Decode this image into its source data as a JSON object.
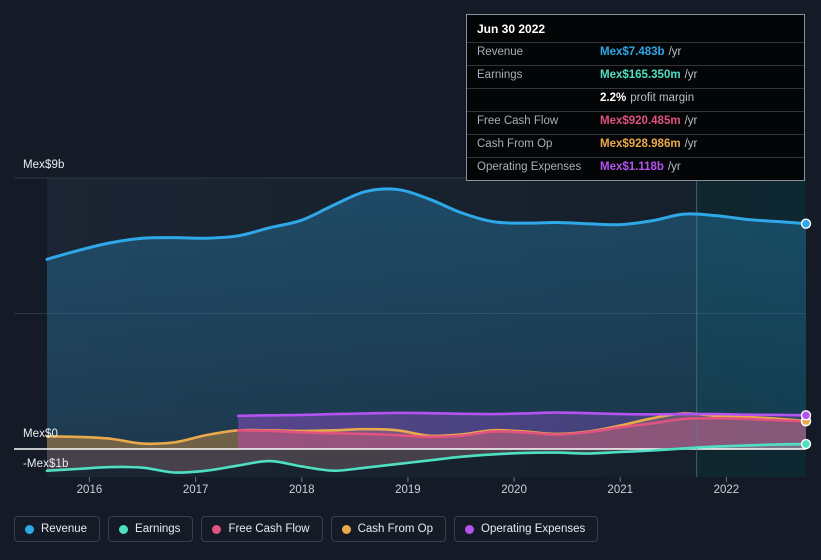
{
  "background": "#151b26",
  "colors": {
    "revenue": "#2ea8e8",
    "earnings": "#4fe0c4",
    "free_cash_flow": "#e0527f",
    "cash_from_op": "#eaa94b",
    "operating_expenses": "#b453f0",
    "zero_line": "#ffffff",
    "grid": "#3a4456",
    "forecast_divider": "#4c7f8c"
  },
  "tooltip": {
    "date": "Jun 30 2022",
    "rows": [
      {
        "label": "Revenue",
        "value": "Mex$7.483b",
        "unit": "/yr",
        "color": "#2ea8e8"
      },
      {
        "label": "Earnings",
        "value": "Mex$165.350m",
        "unit": "/yr",
        "color": "#4fe0c4"
      },
      {
        "label": "",
        "margin_value": "2.2%",
        "margin_text": "profit margin"
      },
      {
        "label": "Free Cash Flow",
        "value": "Mex$920.485m",
        "unit": "/yr",
        "color": "#e0527f"
      },
      {
        "label": "Cash From Op",
        "value": "Mex$928.986m",
        "unit": "/yr",
        "color": "#eaa94b"
      },
      {
        "label": "Operating Expenses",
        "value": "Mex$1.118b",
        "unit": "/yr",
        "color": "#b453f0"
      }
    ]
  },
  "legend": {
    "items": [
      {
        "label": "Revenue",
        "color": "#2ea8e8"
      },
      {
        "label": "Earnings",
        "color": "#4fe0c4"
      },
      {
        "label": "Free Cash Flow",
        "color": "#e0527f"
      },
      {
        "label": "Cash From Op",
        "color": "#eaa94b"
      },
      {
        "label": "Operating Expenses",
        "color": "#b453f0"
      }
    ]
  },
  "axis": {
    "y_labels": [
      {
        "text": "Mex$9b",
        "value": 9
      },
      {
        "text": "Mex$0",
        "value": 0
      },
      {
        "text": "-Mex$1b",
        "value": -1
      }
    ],
    "x_labels": [
      "2016",
      "2017",
      "2018",
      "2019",
      "2020",
      "2021",
      "2022"
    ]
  },
  "chart_data": {
    "type": "area",
    "title": "",
    "xlabel": "",
    "ylabel": "Mex$",
    "ylim": [
      -1.5,
      9.5
    ],
    "xlim": [
      2015.6,
      2022.75
    ],
    "grid": true,
    "legend_position": "bottom",
    "currency_prefix": "Mex$",
    "x": [
      2015.6,
      2015.9,
      2016.2,
      2016.5,
      2016.8,
      2017.1,
      2017.4,
      2017.7,
      2018.0,
      2018.3,
      2018.6,
      2018.9,
      2019.2,
      2019.5,
      2019.8,
      2020.1,
      2020.4,
      2020.7,
      2021.0,
      2021.3,
      2021.6,
      2021.9,
      2022.2,
      2022.5,
      2022.75
    ],
    "x_tick_values": [
      2016,
      2017,
      2018,
      2019,
      2020,
      2021,
      2022
    ],
    "forecast_divider_x": 2021.72,
    "series": [
      {
        "name": "Revenue",
        "color": "#2ea8e8",
        "unit": "Mex$b",
        "values": [
          6.3,
          6.6,
          6.85,
          7.0,
          7.02,
          7.0,
          7.08,
          7.35,
          7.6,
          8.1,
          8.55,
          8.62,
          8.3,
          7.85,
          7.55,
          7.5,
          7.52,
          7.48,
          7.45,
          7.58,
          7.8,
          7.75,
          7.62,
          7.55,
          7.483
        ],
        "last_value": 7.483,
        "last_label": "Mex$7.483b"
      },
      {
        "name": "Earnings",
        "color": "#4fe0c4",
        "unit": "Mex$b",
        "values": [
          -0.72,
          -0.66,
          -0.6,
          -0.62,
          -0.78,
          -0.72,
          -0.55,
          -0.4,
          -0.58,
          -0.72,
          -0.62,
          -0.5,
          -0.38,
          -0.26,
          -0.18,
          -0.13,
          -0.12,
          -0.15,
          -0.1,
          -0.05,
          0.02,
          0.08,
          0.12,
          0.15,
          0.165
        ],
        "last_value": 0.165,
        "last_label": "Mex$165.350m"
      },
      {
        "name": "Free Cash Flow",
        "color": "#e0527f",
        "unit": "Mex$b",
        "values": [
          null,
          null,
          null,
          null,
          null,
          null,
          0.62,
          0.6,
          0.55,
          0.52,
          0.5,
          0.46,
          0.4,
          0.44,
          0.58,
          0.55,
          0.48,
          0.56,
          0.72,
          0.85,
          1.0,
          1.02,
          1.0,
          0.95,
          0.92
        ],
        "start_x": 2017.4,
        "last_value": 0.92,
        "last_label": "Mex$920.485m"
      },
      {
        "name": "Cash From Op",
        "color": "#eaa94b",
        "unit": "Mex$b",
        "values": [
          0.42,
          0.4,
          0.34,
          0.18,
          0.22,
          0.46,
          0.62,
          0.62,
          0.6,
          0.62,
          0.66,
          0.62,
          0.44,
          0.48,
          0.62,
          0.58,
          0.5,
          0.58,
          0.78,
          1.02,
          1.18,
          1.1,
          1.06,
          1.0,
          0.929
        ],
        "last_value": 0.929,
        "last_label": "Mex$928.986m"
      },
      {
        "name": "Operating Expenses",
        "color": "#b453f0",
        "unit": "Mex$b",
        "values": [
          null,
          null,
          null,
          null,
          null,
          null,
          1.1,
          1.12,
          1.13,
          1.16,
          1.18,
          1.2,
          1.19,
          1.17,
          1.16,
          1.18,
          1.21,
          1.19,
          1.16,
          1.15,
          1.16,
          1.16,
          1.14,
          1.13,
          1.118
        ],
        "start_x": 2017.4,
        "last_value": 1.118,
        "last_label": "Mex$1.118b"
      }
    ]
  }
}
